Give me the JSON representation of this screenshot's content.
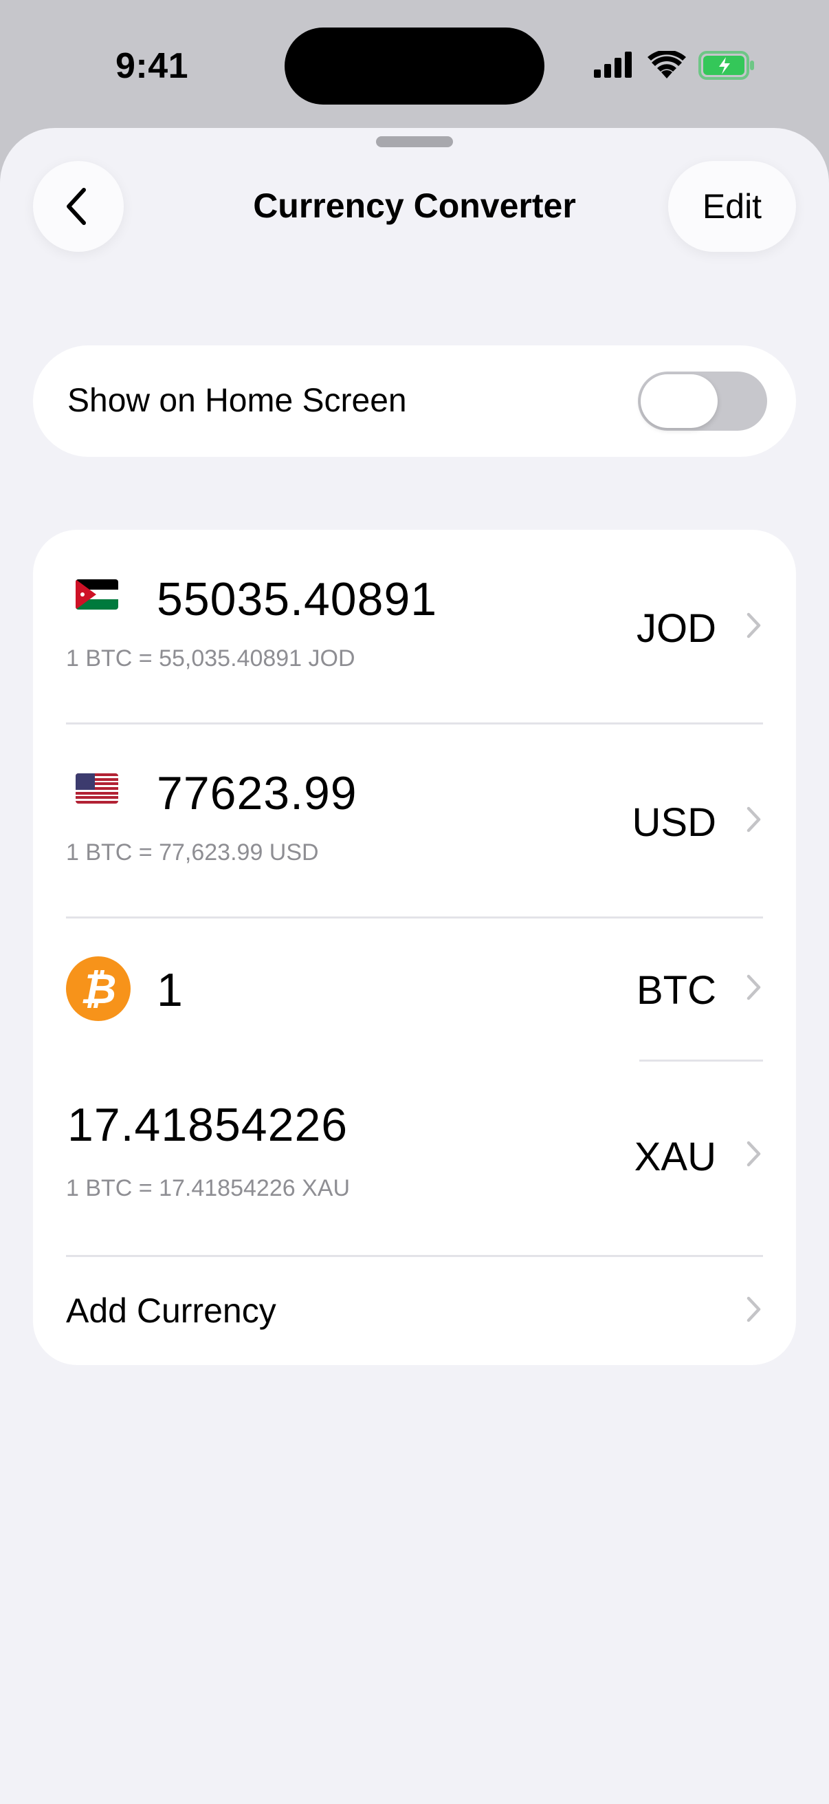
{
  "status_bar": {
    "time": "9:41"
  },
  "nav": {
    "title": "Currency Converter",
    "edit_label": "Edit"
  },
  "home_toggle": {
    "label": "Show on Home Screen",
    "on": false
  },
  "currencies": [
    {
      "flag": "jordan-flag",
      "amount": "55035.40891",
      "rate": "1 BTC = 55,035.40891 JOD",
      "code": "JOD"
    },
    {
      "flag": "us-flag",
      "amount": "77623.99",
      "rate": "1 BTC = 77,623.99 USD",
      "code": "USD"
    },
    {
      "flag": "bitcoin-icon",
      "amount": "1",
      "rate": "",
      "code": "BTC",
      "symbol": "₿"
    },
    {
      "flag": "",
      "amount": "17.41854226",
      "rate": "1 BTC = 17.41854226 XAU",
      "code": "XAU"
    }
  ],
  "add_currency": {
    "label": "Add Currency"
  },
  "colors": {
    "background": "#f2f2f7",
    "bitcoin": "#f7931a",
    "battery": "#34c759",
    "secondary_text": "#8e8e93"
  }
}
